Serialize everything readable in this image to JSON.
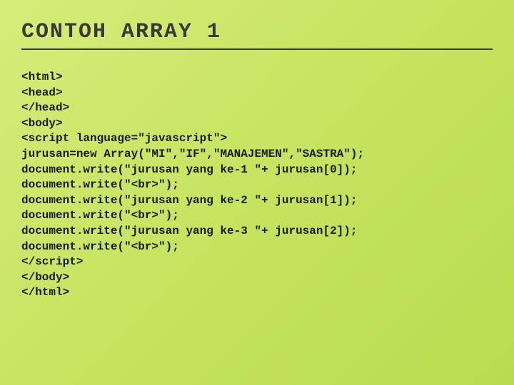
{
  "title": "CONTOH ARRAY 1",
  "code_lines": [
    "<html>",
    "<head>",
    "</head>",
    "<body>",
    "<script language=\"javascript\">",
    "jurusan=new Array(\"MI\",\"IF\",\"MANAJEMEN\",\"SASTRA\");",
    "document.write(\"jurusan yang ke-1 \"+ jurusan[0]);",
    "document.write(\"<br>\");",
    "document.write(\"jurusan yang ke-2 \"+ jurusan[1]);",
    "document.write(\"<br>\");",
    "document.write(\"jurusan yang ke-3 \"+ jurusan[2]);",
    "document.write(\"<br>\");",
    "</script>",
    "</body>",
    "</html>"
  ]
}
